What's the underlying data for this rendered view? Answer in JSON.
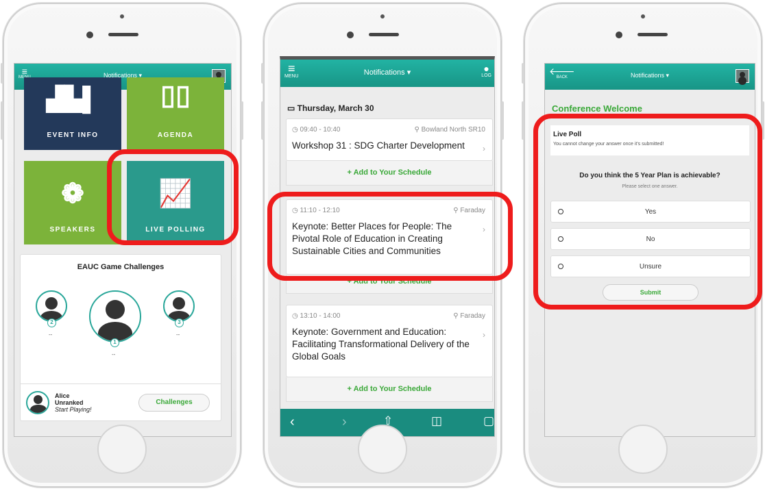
{
  "colors": {
    "teal": "#189586",
    "green": "#3aa838",
    "tile_green": "#7cb33a",
    "navy": "#23395a",
    "highlight": "#ee1c1c"
  },
  "topbar": {
    "menu_label": "MENU",
    "back_label": "BACK",
    "notifications": "Notifications ▾",
    "login_label": "LOG"
  },
  "phone1": {
    "tiles": [
      {
        "label": "EVENT INFO",
        "icon": "city-icon"
      },
      {
        "label": "AGENDA",
        "icon": "book-icon"
      },
      {
        "label": "SPEAKERS",
        "icon": "flower-icon"
      },
      {
        "label": "LIVE POLLING",
        "icon": "chart-icon"
      }
    ],
    "game": {
      "title": "EAUC Game Challenges",
      "ranks": [
        {
          "num": "2",
          "score": "--"
        },
        {
          "num": "1",
          "score": "--"
        },
        {
          "num": "3",
          "score": "--"
        }
      ],
      "user_name": "Alice",
      "user_rank": "Unranked",
      "user_status": "Start Playing!",
      "challenges_button": "Challenges"
    }
  },
  "phone2": {
    "date": "Thursday, March 30",
    "sessions": [
      {
        "time": "09:40 - 10:40",
        "location": "Bowland North SR10",
        "title": "Workshop 31 : SDG Charter Development"
      },
      {
        "time": "11:10 - 12:10",
        "location": "Faraday",
        "title": "Keynote: Better Places for People: The Pivotal Role of Education in Creating Sustainable Cities and Communities"
      },
      {
        "time": "13:10 - 14:00",
        "location": "Faraday",
        "title": "Keynote: Government and Education: Facilitating Transformational Delivery of the Global Goals"
      }
    ],
    "add_label": "Add to Your Schedule",
    "add_plus": "+"
  },
  "phone3": {
    "heading": "Conference Welcome",
    "poll_title": "Live Poll",
    "poll_note": "You cannot change your answer once it's submitted!",
    "question": "Do you think the 5 Year Plan is achievable?",
    "hint": "Please select one answer.",
    "options": [
      "Yes",
      "No",
      "Unsure"
    ],
    "submit": "Submit"
  }
}
